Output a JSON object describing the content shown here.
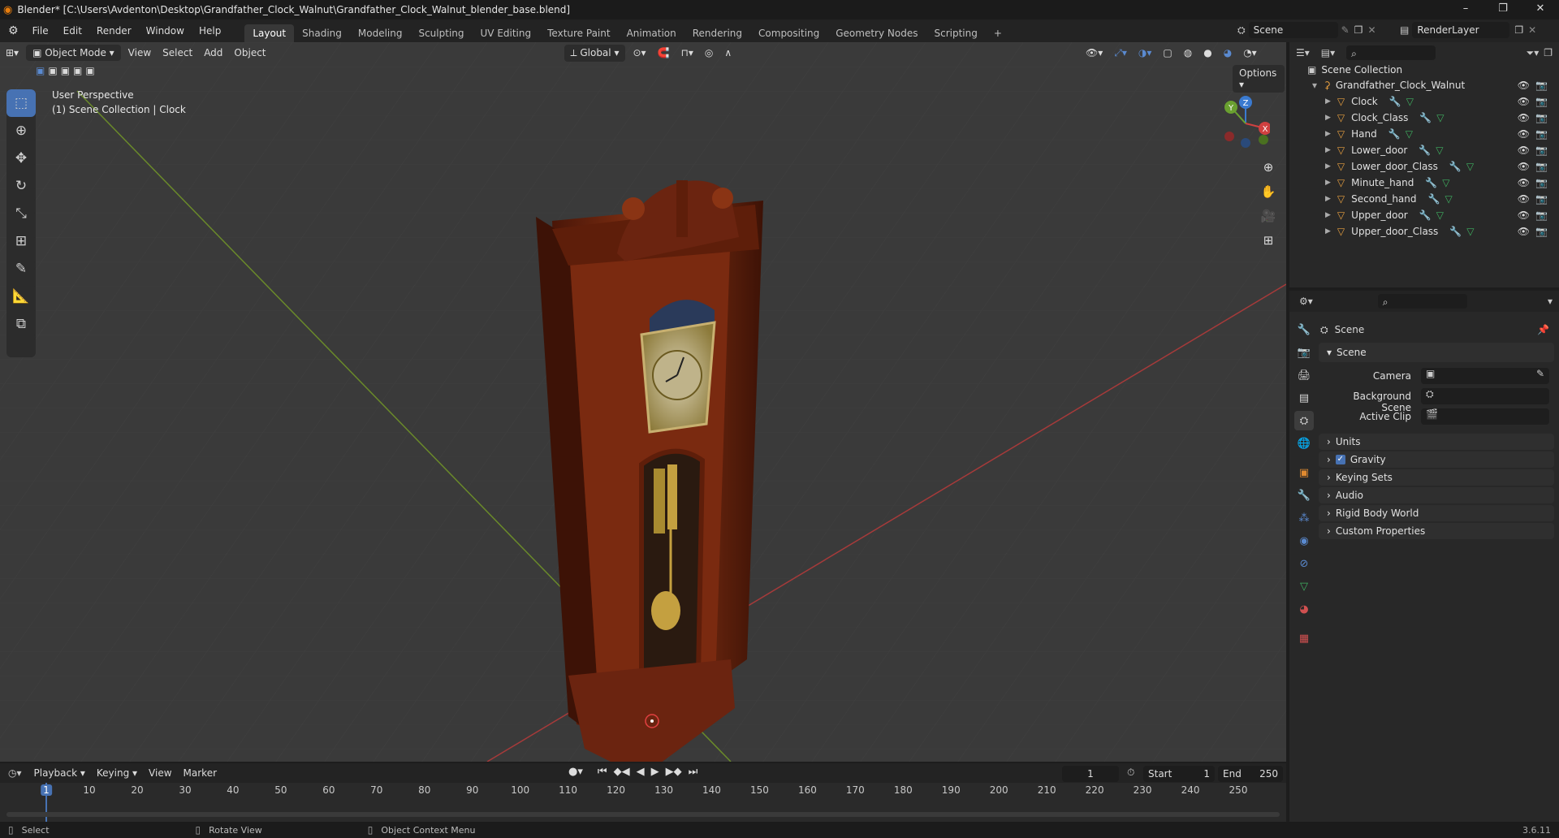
{
  "window": {
    "title": "Blender* [C:\\Users\\Avdenton\\Desktop\\Grandfather_Clock_Walnut\\Grandfather_Clock_Walnut_blender_base.blend]",
    "minimize": "–",
    "maximize": "❐",
    "close": "✕"
  },
  "menubar": {
    "items": [
      "File",
      "Edit",
      "Render",
      "Window",
      "Help"
    ]
  },
  "workspaces": {
    "tabs": [
      "Layout",
      "Shading",
      "Modeling",
      "Sculpting",
      "UV Editing",
      "Texture Paint",
      "Animation",
      "Rendering",
      "Compositing",
      "Geometry Nodes",
      "Scripting"
    ],
    "active": "Layout",
    "add": "+"
  },
  "scene_selector": {
    "value": "Scene"
  },
  "layer_selector": {
    "value": "RenderLayer"
  },
  "viewport_header": {
    "mode": "Object Mode",
    "menus": [
      "View",
      "Select",
      "Add",
      "Object"
    ],
    "transform_orientation": "Global",
    "options": "Options"
  },
  "viewport": {
    "perspective": "User Perspective",
    "collection_info": "(1) Scene Collection | Clock"
  },
  "gizmo": {
    "x": "X",
    "y": "Y",
    "z": "Z"
  },
  "outliner": {
    "root": "Scene Collection",
    "collection": "Grandfather_Clock_Walnut",
    "objects": [
      "Clock",
      "Clock_Class",
      "Hand",
      "Lower_door",
      "Lower_door_Class",
      "Minute_hand",
      "Second_hand",
      "Upper_door",
      "Upper_door_Class"
    ]
  },
  "properties": {
    "context": "Scene",
    "section": "Scene",
    "fields": {
      "camera": "Camera",
      "background_scene": "Background Scene",
      "active_clip": "Active Clip"
    },
    "panels": [
      "Units",
      "Gravity",
      "Keying Sets",
      "Audio",
      "Rigid Body World",
      "Custom Properties"
    ],
    "gravity_checked": true
  },
  "timeline": {
    "menus": [
      "Playback",
      "Keying",
      "View",
      "Marker"
    ],
    "current_frame": "1",
    "start_label": "Start",
    "start": "1",
    "end_label": "End",
    "end": "250",
    "ticks": [
      "1",
      "10",
      "20",
      "30",
      "40",
      "50",
      "60",
      "70",
      "80",
      "90",
      "100",
      "110",
      "120",
      "130",
      "140",
      "150",
      "160",
      "170",
      "180",
      "190",
      "200",
      "210",
      "220",
      "230",
      "240",
      "250"
    ]
  },
  "statusbar": {
    "select": "Select",
    "rotate": "Rotate View",
    "context": "Object Context Menu",
    "version": "3.6.11"
  },
  "colors": {
    "accent": "#4772b3",
    "grid_x": "#a63a3a",
    "grid_y": "#6a8a2a",
    "wood": "#6b2410"
  }
}
